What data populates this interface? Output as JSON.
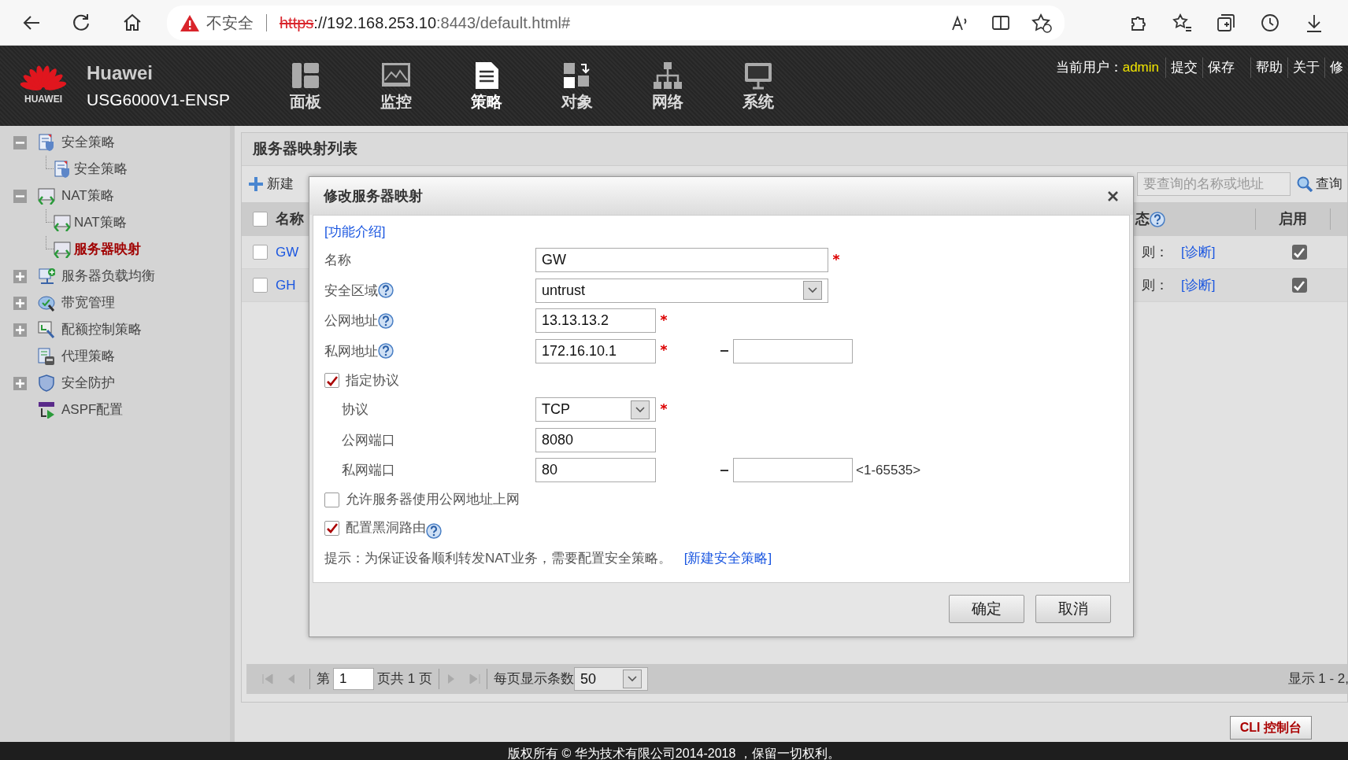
{
  "browser": {
    "warning": "不安全",
    "url_parts": [
      {
        "text": "https",
        "kind": "insecure_scheme"
      },
      {
        "text": "://192.168.253.10",
        "kind": "host"
      },
      {
        "text": ":8443/default.html#",
        "kind": "path"
      }
    ]
  },
  "header": {
    "logo_text": "HUAWEI",
    "brand": "Huawei",
    "model": "USG6000V1-ENSP",
    "nav": [
      {
        "label": "面板",
        "selected": false
      },
      {
        "label": "监控",
        "selected": false
      },
      {
        "label": "策略",
        "selected": true
      },
      {
        "label": "对象",
        "selected": false
      },
      {
        "label": "网络",
        "selected": false
      },
      {
        "label": "系统",
        "selected": false
      }
    ],
    "user_label": "当前用户：",
    "user": "admin",
    "actions": [
      "提交",
      "保存",
      "帮助",
      "关于",
      "修"
    ]
  },
  "sidebar": {
    "items": [
      {
        "label": "安全策略",
        "kind": "folder",
        "expanded": true,
        "selected": false,
        "children": [
          {
            "label": "安全策略",
            "selected": false
          }
        ]
      },
      {
        "label": "NAT策略",
        "kind": "folder",
        "expanded": true,
        "selected": false,
        "children": [
          {
            "label": "NAT策略",
            "selected": false
          },
          {
            "label": "服务器映射",
            "selected": true
          }
        ]
      },
      {
        "label": "服务器负载均衡",
        "kind": "folder",
        "expanded": false,
        "selected": false
      },
      {
        "label": "带宽管理",
        "kind": "folder",
        "expanded": false,
        "selected": false
      },
      {
        "label": "配额控制策略",
        "kind": "folder",
        "expanded": false,
        "selected": false
      },
      {
        "label": "代理策略",
        "kind": "leaf",
        "selected": false
      },
      {
        "label": "安全防护",
        "kind": "folder",
        "expanded": false,
        "selected": false
      },
      {
        "label": "ASPF配置",
        "kind": "leaf",
        "selected": false
      }
    ]
  },
  "panel": {
    "title": "服务器映射列表",
    "new_button": "新建",
    "search": {
      "placeholder": "要查询的名称或地址"
    },
    "search_button": "查询",
    "table": {
      "columns": [
        {
          "label": "名称"
        },
        {
          "label": "态",
          "help": true
        },
        {
          "label": "启用",
          "help": false
        }
      ],
      "header_checked": false,
      "rows": [
        {
          "name": "GW",
          "selected": false,
          "status": "则：",
          "link": "[诊断]",
          "enabled": true
        },
        {
          "name": "GH",
          "selected": false,
          "status": "则：",
          "link": "[诊断]",
          "enabled": true
        }
      ]
    },
    "pager": {
      "page_prefix": "第",
      "page": "1",
      "page_suffix": "页共 1 页",
      "size_label": "每页显示条数",
      "size": "50",
      "summary": "显示 1 - 2,"
    }
  },
  "dialog": {
    "title": "修改服务器映射",
    "intro_link": "[功能介绍]",
    "fields": [
      {
        "kind": "wide_text",
        "label": "名称",
        "help": false,
        "value": "GW",
        "required": true,
        "range": false
      },
      {
        "kind": "wide_select",
        "label": "安全区域",
        "help": true,
        "value": "untrust",
        "required": false,
        "range": false
      },
      {
        "kind": "text",
        "label": "公网地址",
        "help": true,
        "value": "13.13.13.2",
        "required": true,
        "range": false
      },
      {
        "kind": "text",
        "label": "私网地址",
        "help": true,
        "value": "172.16.10.1",
        "required": true,
        "range": true
      },
      {
        "kind": "checkbox",
        "label": "指定协议",
        "help": false,
        "checked": true,
        "children": [
          {
            "kind": "select",
            "label": "协议",
            "help": false,
            "value": "TCP",
            "required": true,
            "range": false
          },
          {
            "kind": "text",
            "label": "公网端口",
            "help": false,
            "value": "8080",
            "required": false,
            "range": false
          },
          {
            "kind": "text",
            "label": "私网端口",
            "help": false,
            "value": "80",
            "required": false,
            "range": true,
            "range_hint": "<1-65535>"
          }
        ]
      },
      {
        "kind": "checkbox",
        "label": "允许服务器使用公网地址上网",
        "help": false,
        "checked": false
      },
      {
        "kind": "checkbox",
        "label": "配置黑洞路由",
        "help": true,
        "checked": true
      }
    ],
    "hint": "提示：为保证设备顺利转发NAT业务，需要配置安全策略。",
    "hint_link": "[新建安全策略]",
    "buttons": [
      "确定",
      "取消"
    ]
  },
  "cli_button": "CLI 控制台",
  "footer": "版权所有 © 华为技术有限公司2014-2018 ，保留一切权利。"
}
